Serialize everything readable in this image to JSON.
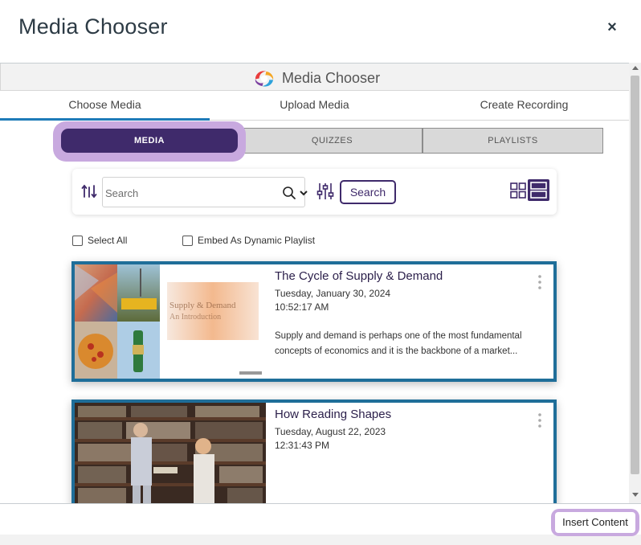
{
  "modal": {
    "title": "Media Chooser",
    "close_label": "×"
  },
  "brand": {
    "name": "Media Chooser",
    "logo_icon": "kaltura-swirl-logo"
  },
  "tabs": [
    {
      "label": "Choose Media",
      "active": true
    },
    {
      "label": "Upload Media",
      "active": false
    },
    {
      "label": "Create Recording",
      "active": false
    }
  ],
  "subtabs": [
    {
      "label": "MEDIA",
      "active": true
    },
    {
      "label": "QUIZZES",
      "active": false
    },
    {
      "label": "PLAYLISTS",
      "active": false
    }
  ],
  "search": {
    "placeholder": "Search",
    "button_label": "Search",
    "icons": [
      "sort-filter-icon",
      "search-icon",
      "chevron-down-icon",
      "sliders-icon",
      "grid-view-icon",
      "list-view-icon"
    ]
  },
  "options": {
    "select_all": "Select All",
    "embed_playlist": "Embed As Dynamic Playlist"
  },
  "media_items": [
    {
      "title": "The Cycle of Supply & Demand",
      "date": "Tuesday, January 30, 2024",
      "time": "10:52:17 AM",
      "description": "Supply and demand is perhaps one of the most fundamental concepts of economics and it is the backbone of a market..."
    },
    {
      "title": "How Reading Shapes",
      "date": "Tuesday, August 22, 2023",
      "time": "12:31:43 PM",
      "description": ""
    }
  ],
  "footer": {
    "insert_label": "Insert Content"
  },
  "colors": {
    "accent_purple": "#3f2a6b",
    "highlight_lavender": "#c8a9df",
    "card_border_blue": "#1f6e99",
    "tab_active_blue": "#1e7bb8"
  }
}
